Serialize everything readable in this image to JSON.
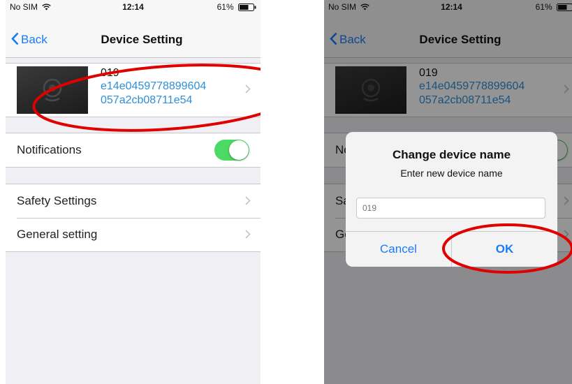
{
  "status_bar": {
    "carrier": "No SIM",
    "time": "12:14",
    "battery": "61%"
  },
  "nav": {
    "back_label": "Back",
    "title": "Device Setting"
  },
  "device": {
    "name": "019",
    "id_line1": "e14e0459778899604",
    "id_line2": "057a2cb08711e54"
  },
  "notifications": {
    "label": "Notifications",
    "enabled": true
  },
  "settings_items": [
    {
      "label": "Safety Settings"
    },
    {
      "label": "General setting"
    }
  ],
  "dialog": {
    "title": "Change device name",
    "message": "Enter new device name",
    "input_placeholder": "019",
    "cancel_label": "Cancel",
    "ok_label": "OK"
  },
  "colors": {
    "accent": "#1a7cf5",
    "link": "#2e8fd8",
    "toggle_on": "#4cd964",
    "annotation": "#e00000"
  }
}
